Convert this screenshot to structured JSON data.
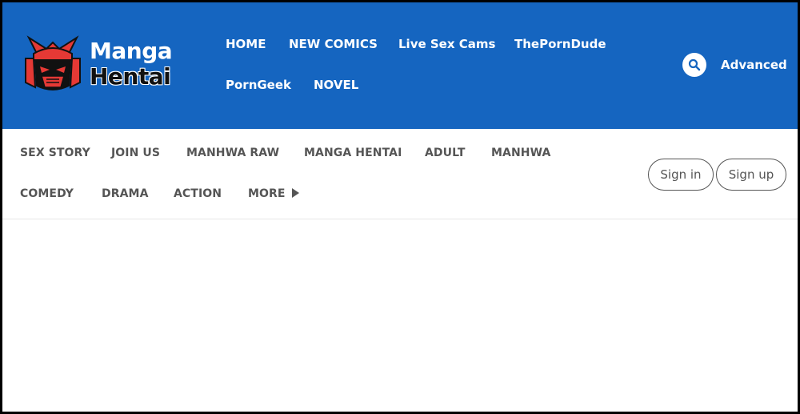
{
  "brand": {
    "line1": "Manga",
    "line2": "Hentai",
    "mascot_icon": "samurai-mask-icon"
  },
  "top_nav": {
    "items": [
      {
        "label": "HOME"
      },
      {
        "label": "NEW COMICS"
      },
      {
        "label": "Live Sex Cams"
      },
      {
        "label": "ThePornDude"
      },
      {
        "label": "PornGeek"
      },
      {
        "label": "NOVEL"
      }
    ]
  },
  "search": {
    "icon": "search-icon",
    "advanced_label": "Advanced"
  },
  "sub_nav": {
    "items": [
      {
        "label": "SEX STORY"
      },
      {
        "label": "JOIN US"
      },
      {
        "label": "MANHWA RAW"
      },
      {
        "label": "MANGA HENTAI"
      },
      {
        "label": "ADULT"
      },
      {
        "label": "MANHWA"
      },
      {
        "label": "COMEDY"
      },
      {
        "label": "DRAMA"
      },
      {
        "label": "ACTION"
      },
      {
        "label": "MORE"
      }
    ]
  },
  "auth": {
    "signin_label": "Sign in",
    "signup_label": "Sign up"
  },
  "colors": {
    "header_blue": "#1565c0",
    "mascot_red": "#e53935",
    "nav_text": "#555555"
  }
}
